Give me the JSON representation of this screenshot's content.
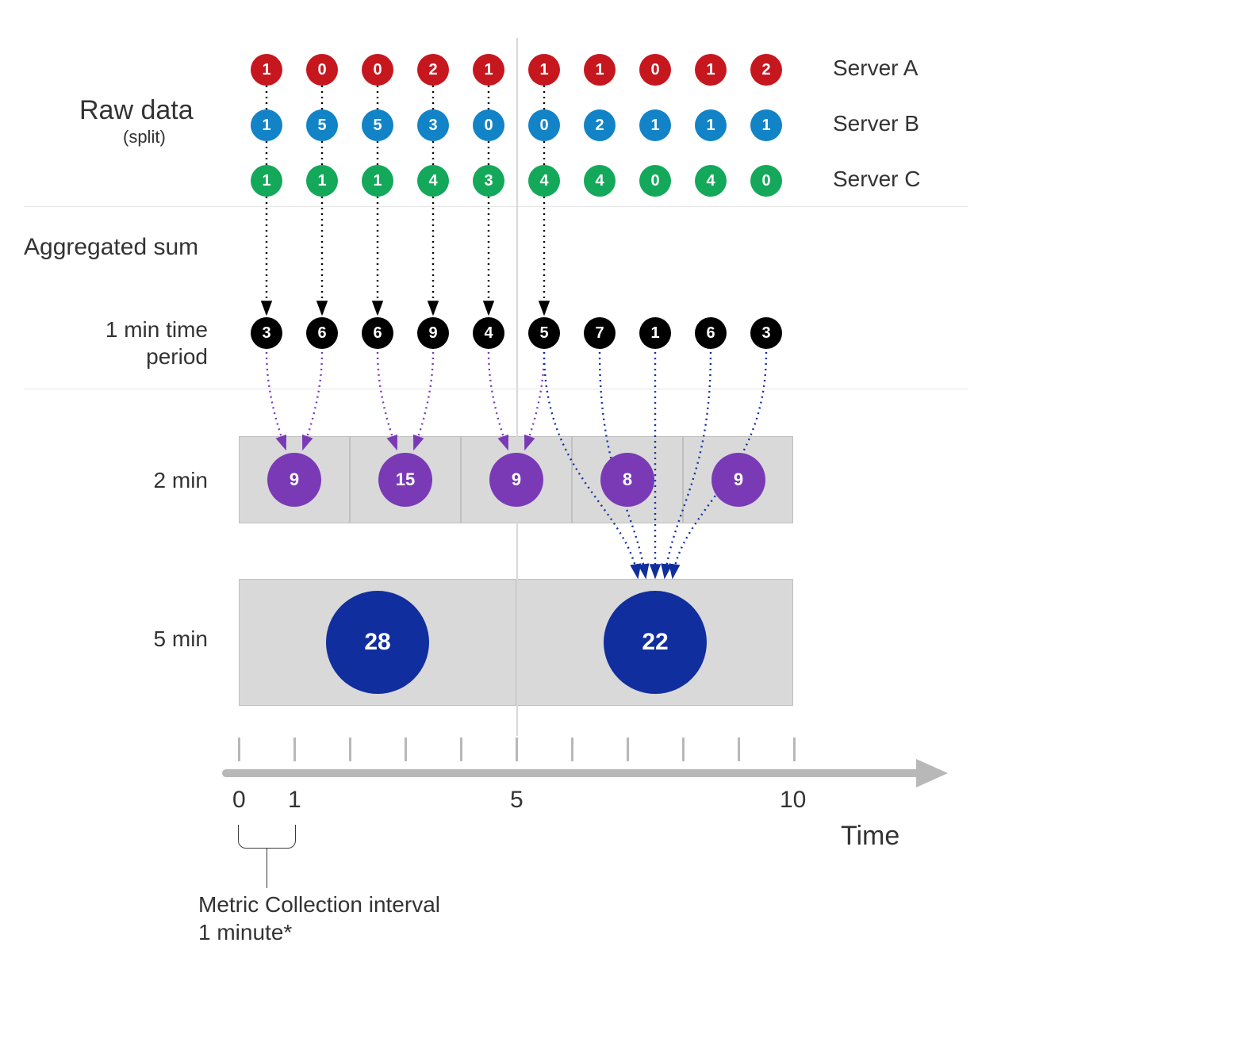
{
  "chart_data": {
    "type": "table",
    "time_points": [
      1,
      2,
      3,
      4,
      5,
      6,
      7,
      8,
      9,
      10
    ],
    "series": [
      {
        "name": "Server A",
        "values": [
          1,
          0,
          0,
          2,
          1,
          1,
          1,
          0,
          1,
          2
        ],
        "color": "#c7171e"
      },
      {
        "name": "Server B",
        "values": [
          1,
          5,
          5,
          3,
          0,
          0,
          2,
          1,
          1,
          1
        ],
        "color": "#1183c6"
      },
      {
        "name": "Server C",
        "values": [
          1,
          1,
          1,
          4,
          3,
          4,
          4,
          0,
          4,
          0
        ],
        "color": "#14a85a"
      }
    ],
    "sum_1min": [
      3,
      6,
      6,
      9,
      4,
      5,
      7,
      1,
      6,
      3
    ],
    "sum_2min": [
      9,
      15,
      9,
      8,
      9
    ],
    "sum_5min": [
      28,
      22
    ],
    "xticks": {
      "0": 0,
      "1": 1,
      "5": 5,
      "10": 10
    },
    "xlabel": "Time"
  },
  "labels": {
    "raw_title": "Raw data",
    "raw_subtitle": "(split)",
    "agg_title": "Aggregated sum",
    "row_1min_l1": "1 min time",
    "row_1min_l2": "period",
    "row_2min": "2 min",
    "row_5min": "5 min",
    "server": {
      "a": "Server A",
      "b": "Server B",
      "c": "Server C"
    },
    "axis_time": "Time",
    "tick0": "0",
    "tick1": "1",
    "tick5": "5",
    "tick10": "10",
    "interval_l1": "Metric Collection interval",
    "interval_l2": "1 minute*"
  }
}
